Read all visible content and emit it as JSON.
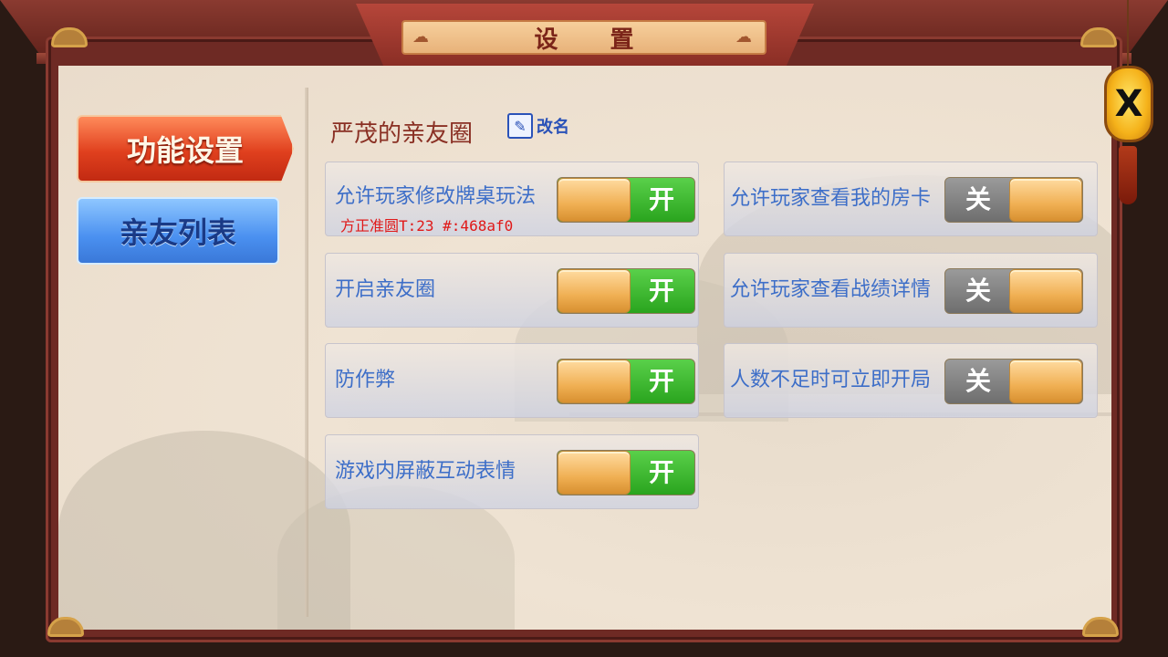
{
  "window": {
    "title": "设 置"
  },
  "close": {
    "label": "X"
  },
  "menu": {
    "items": [
      {
        "label": "功能设置",
        "active": true
      },
      {
        "label": "亲友列表",
        "active": false
      }
    ]
  },
  "circle": {
    "name": "严茂的亲友圈",
    "rename_label": "改名"
  },
  "settings": {
    "left": [
      {
        "label": "允许玩家修改牌桌玩法",
        "state": "开",
        "on": true,
        "sub": "方正准圆T:23 #:468af0"
      },
      {
        "label": "开启亲友圈",
        "state": "开",
        "on": true
      },
      {
        "label": "防作弊",
        "state": "开",
        "on": true
      },
      {
        "label": "游戏内屏蔽互动表情",
        "state": "开",
        "on": true
      }
    ],
    "right": [
      {
        "label": "允许玩家查看我的房卡",
        "state": "关",
        "on": false
      },
      {
        "label": "允许玩家查看战绩详情",
        "state": "关",
        "on": false
      },
      {
        "label": "人数不足时可立即开局",
        "state": "关",
        "on": false
      }
    ]
  },
  "colors": {
    "accent_on": "#2aa41e",
    "accent_off": "#6e6e6e",
    "label_blue": "#3d6ec8",
    "title_red": "#8a3024",
    "debug_red": "#e01818"
  },
  "icons": {
    "rename": "edit-pencil-icon",
    "close": "close-x-icon"
  }
}
